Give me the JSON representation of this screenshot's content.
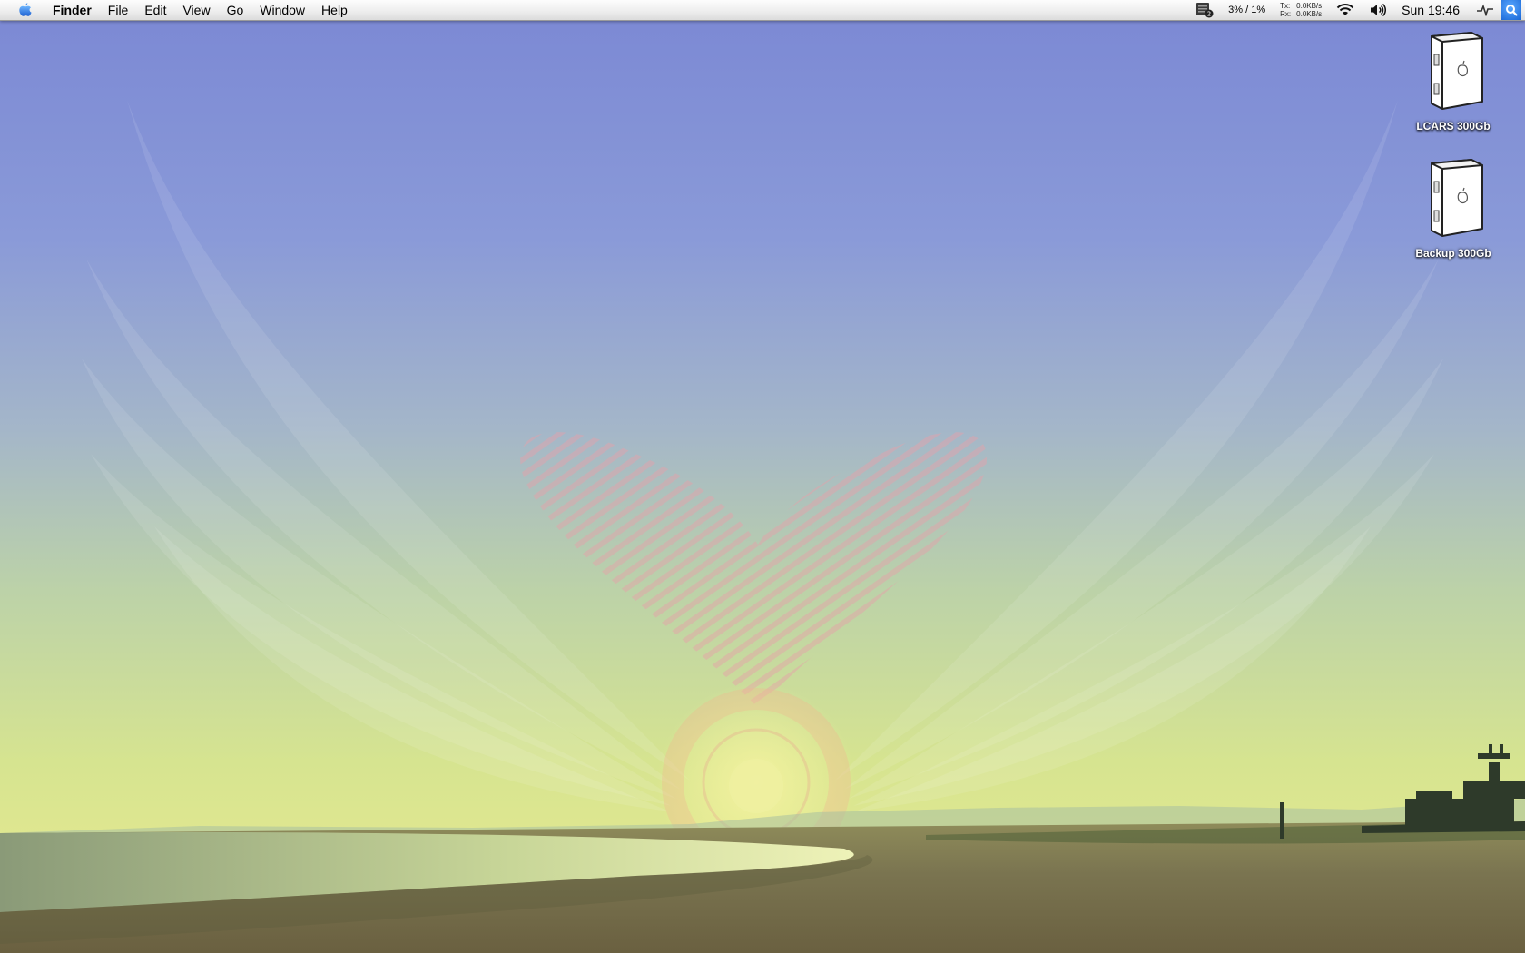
{
  "menubar": {
    "apple_icon": "apple-icon",
    "app_name": "Finder",
    "menus": [
      "File",
      "Edit",
      "View",
      "Go",
      "Window",
      "Help"
    ],
    "extras": {
      "calendar_badge": "2",
      "cpu_usage": "3% / 1%",
      "network": {
        "tx_label": "Tx:",
        "tx_value": "0.0KB/s",
        "rx_label": "Rx:",
        "rx_value": "0.0KB/s"
      },
      "wifi_icon": "wifi-icon",
      "volume_icon": "speaker-icon",
      "clock": "Sun 19:46",
      "activity_icon": "activity-icon",
      "spotlight_icon": "spotlight-icon"
    }
  },
  "desktop": {
    "icons": [
      {
        "label": "LCARS 300Gb",
        "icon": "hard-drive-icon"
      },
      {
        "label": "Backup 300Gb",
        "icon": "hard-drive-icon"
      }
    ]
  },
  "colors": {
    "sky_top": "#7b88d4",
    "horizon": "#dfe790",
    "ground": "#6c6645",
    "spotlight": "#1866d6"
  }
}
